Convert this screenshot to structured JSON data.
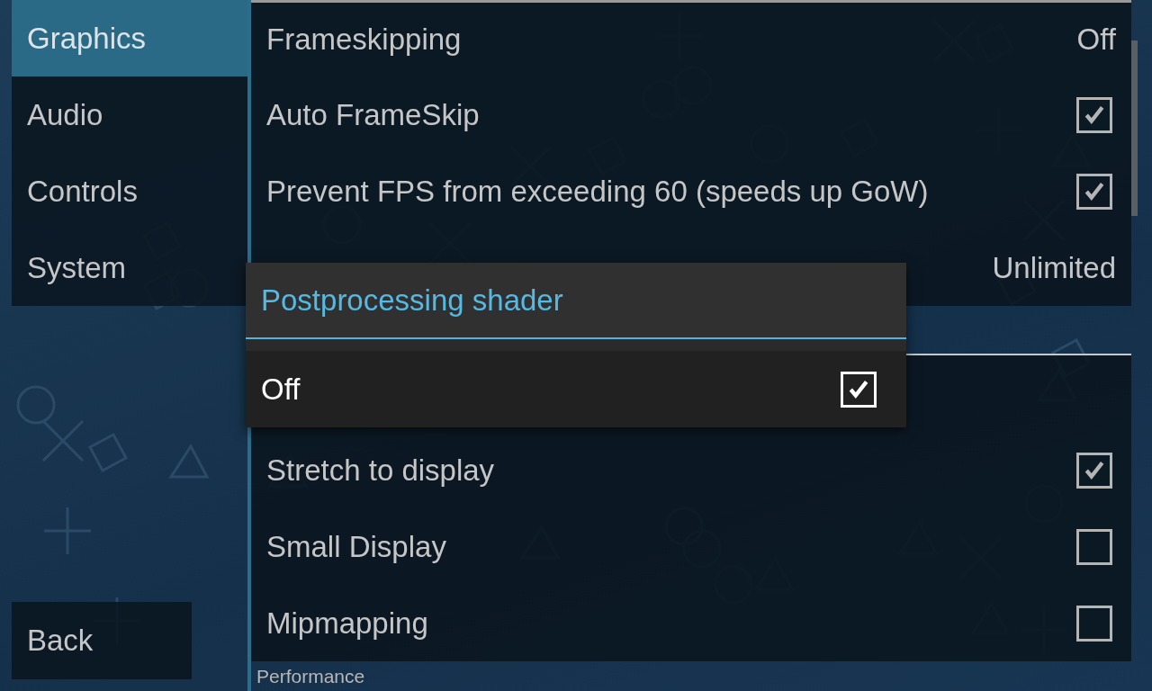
{
  "sidebar": {
    "items": [
      {
        "label": "Graphics",
        "selected": true
      },
      {
        "label": "Audio",
        "selected": false
      },
      {
        "label": "Controls",
        "selected": false
      },
      {
        "label": "System",
        "selected": false
      }
    ],
    "back_button": "Back"
  },
  "settings": {
    "rows": [
      {
        "kind": "value",
        "label": "Frameskipping",
        "value": "Off"
      },
      {
        "kind": "checkbox",
        "label": "Auto FrameSkip",
        "checked": true
      },
      {
        "kind": "checkbox",
        "label": "Prevent FPS from exceeding 60 (speeds up GoW)",
        "checked": true
      },
      {
        "kind": "value",
        "value": "Unlimited"
      },
      {
        "kind": "section"
      },
      {
        "kind": "blank"
      },
      {
        "kind": "checkbox",
        "label": "Stretch to display",
        "checked": true
      },
      {
        "kind": "checkbox",
        "label": "Small Display",
        "checked": false
      },
      {
        "kind": "checkbox",
        "label": "Mipmapping",
        "checked": false
      },
      {
        "kind": "section",
        "title": "Performance"
      }
    ]
  },
  "dialog": {
    "title": "Postprocessing shader",
    "options": [
      {
        "label": "Off",
        "selected": true
      }
    ]
  }
}
